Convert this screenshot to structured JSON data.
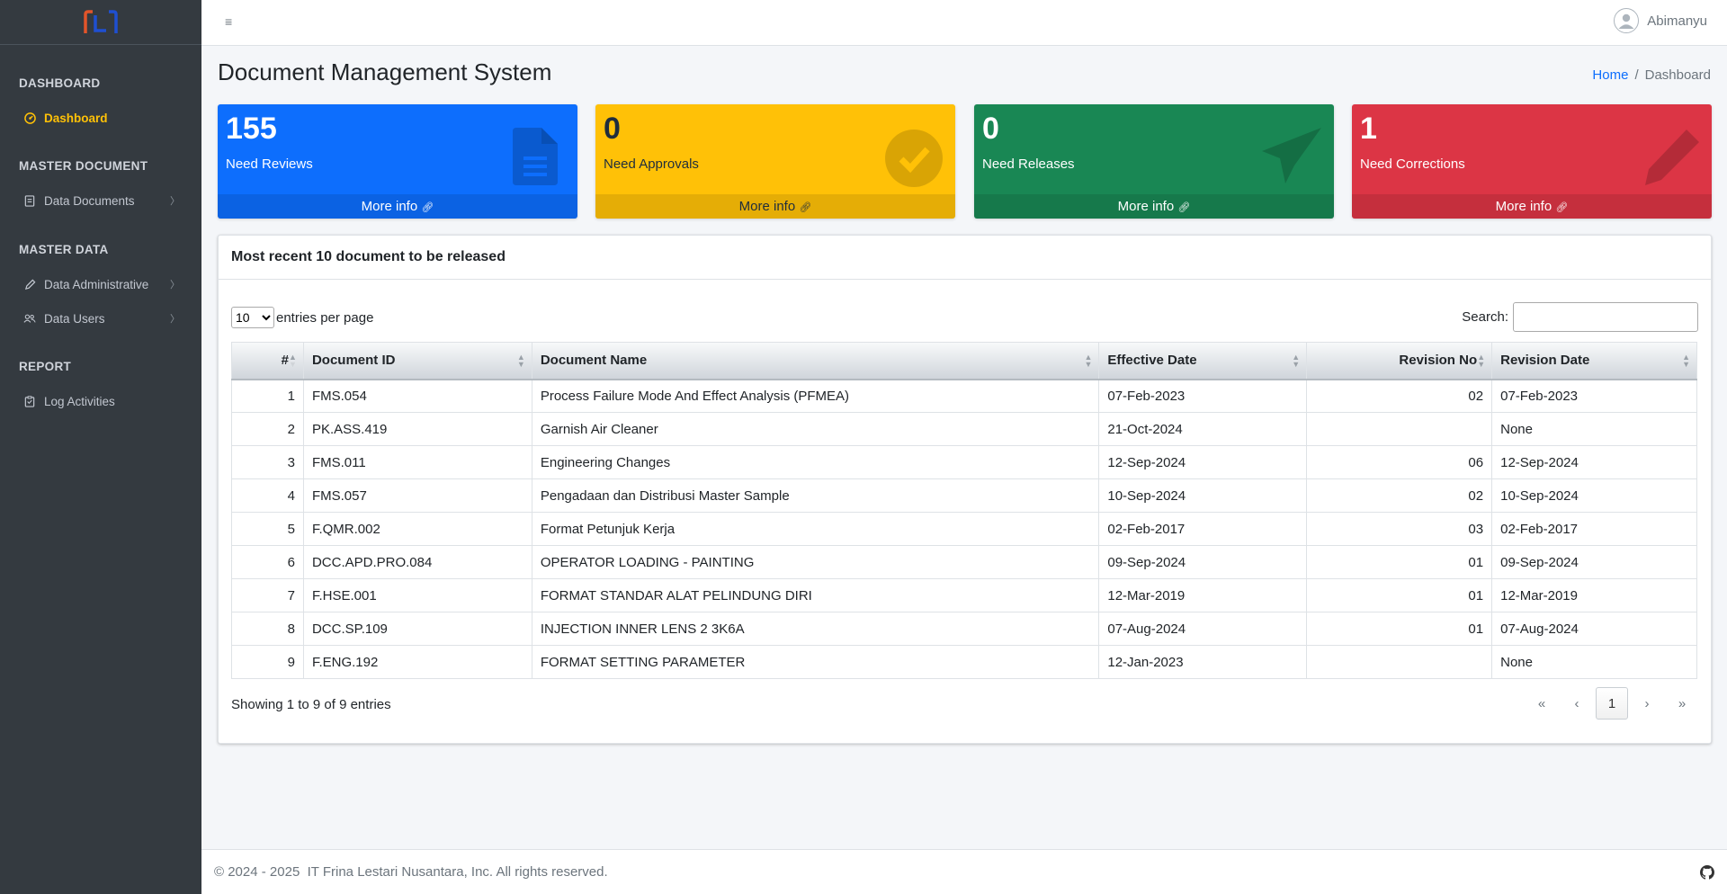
{
  "sidebar": {
    "brand_logo": "company-logo",
    "sections": [
      {
        "header": "DASHBOARD"
      },
      {
        "header": "MASTER DOCUMENT"
      },
      {
        "header": "MASTER DATA"
      },
      {
        "header": "REPORT"
      }
    ],
    "items": [
      {
        "label": "Dashboard",
        "icon": "dashboard-gauge-icon",
        "active": true
      },
      {
        "label": "Data Documents",
        "icon": "document-icon"
      },
      {
        "label": "Data Administrative",
        "icon": "pen-icon"
      },
      {
        "label": "Data Users",
        "icon": "users-icon"
      },
      {
        "label": "Log Activities",
        "icon": "clipboard-icon"
      }
    ],
    "chevron": "〉"
  },
  "topbar": {
    "menu_icon": "≡",
    "user_name": "Abimanyu"
  },
  "page": {
    "title": "Document Management System",
    "breadcrumb": {
      "home": "Home",
      "separator": "/",
      "current": "Dashboard"
    }
  },
  "stats": [
    {
      "value": "155",
      "label": "Need Reviews",
      "footer": "More info",
      "color": "#0d6efd",
      "icon": "file-icon"
    },
    {
      "value": "0",
      "label": "Need Approvals",
      "footer": "More info",
      "color": "#ffc107",
      "icon": "check-circle-icon"
    },
    {
      "value": "0",
      "label": "Need Releases",
      "footer": "More info",
      "color": "#198754",
      "icon": "paper-plane-icon"
    },
    {
      "value": "1",
      "label": "Need Corrections",
      "footer": "More info",
      "color": "#dc3545",
      "icon": "pencil-icon"
    }
  ],
  "recent": {
    "title": "Most recent 10 document to be released",
    "entries_per_page": {
      "value": "10",
      "label": "entries per page"
    },
    "search_label": "Search:",
    "columns": [
      "#",
      "Document ID",
      "Document Name",
      "Effective Date",
      "Revision No",
      "Revision Date"
    ],
    "rows": [
      [
        "1",
        "FMS.054",
        "Process Failure Mode And Effect Analysis (PFMEA)",
        "07-Feb-2023",
        "02",
        "07-Feb-2023"
      ],
      [
        "2",
        "PK.ASS.419",
        "Garnish Air Cleaner",
        "21-Oct-2024",
        "",
        "None"
      ],
      [
        "3",
        "FMS.011",
        "Engineering Changes",
        "12-Sep-2024",
        "06",
        "12-Sep-2024"
      ],
      [
        "4",
        "FMS.057",
        "Pengadaan dan Distribusi Master Sample",
        "10-Sep-2024",
        "02",
        "10-Sep-2024"
      ],
      [
        "5",
        "F.QMR.002",
        "Format Petunjuk Kerja",
        "02-Feb-2017",
        "03",
        "02-Feb-2017"
      ],
      [
        "6",
        "DCC.APD.PRO.084",
        "OPERATOR LOADING - PAINTING",
        "09-Sep-2024",
        "01",
        "09-Sep-2024"
      ],
      [
        "7",
        "F.HSE.001",
        "FORMAT STANDAR ALAT PELINDUNG DIRI",
        "12-Mar-2019",
        "01",
        "12-Mar-2019"
      ],
      [
        "8",
        "DCC.SP.109",
        "INJECTION INNER LENS 2 3K6A",
        "07-Aug-2024",
        "01",
        "07-Aug-2024"
      ],
      [
        "9",
        "F.ENG.192",
        "FORMAT SETTING PARAMETER",
        "12-Jan-2023",
        "",
        "None"
      ]
    ],
    "info": "Showing 1 to 9 of 9 entries",
    "pagination": {
      "first": "«",
      "prev": "‹",
      "current": "1",
      "next": "›",
      "last": "»"
    }
  },
  "footer": {
    "text": "© 2024 - 2025  IT Frina Lestari Nusantara, Inc. All rights reserved.",
    "icon": "github-icon"
  }
}
